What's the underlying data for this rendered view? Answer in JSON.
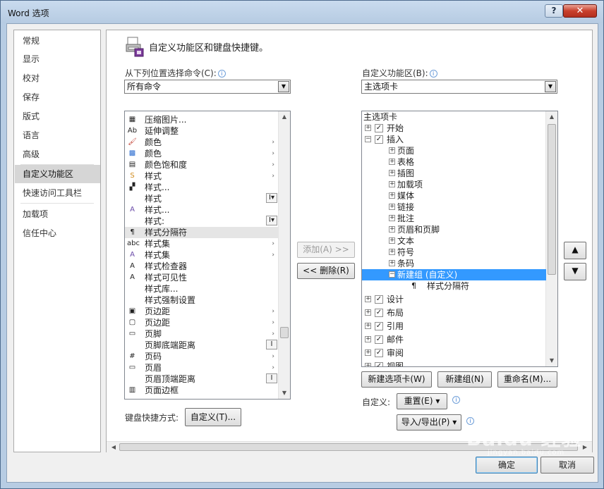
{
  "window": {
    "title": "Word 选项",
    "help_label": "?",
    "close_label": "✕"
  },
  "nav": {
    "items": [
      {
        "label": "常规"
      },
      {
        "label": "显示"
      },
      {
        "label": "校对"
      },
      {
        "label": "保存"
      },
      {
        "label": "版式"
      },
      {
        "label": "语言"
      },
      {
        "label": "高级"
      },
      {
        "label": "自定义功能区"
      },
      {
        "label": "快速访问工具栏"
      },
      {
        "label": "加载项"
      },
      {
        "label": "信任中心"
      }
    ],
    "active": "自定义功能区"
  },
  "main": {
    "heading": "自定义功能区和键盘快捷键。",
    "choose_label": "从下列位置选择命令(C):",
    "choose_value": "所有命令",
    "customize_label": "自定义功能区(B):",
    "customize_value": "主选项卡",
    "info_glyph": "i"
  },
  "commands": [
    {
      "icon": "compress-icon",
      "glyph": "▦",
      "label": "压缩图片..."
    },
    {
      "icon": "stretch-icon",
      "glyph": "Ab",
      "label": "延伸调整"
    },
    {
      "icon": "color-brush-icon",
      "glyph": "🖌",
      "label": "颜色",
      "chev": "›"
    },
    {
      "icon": "color-swatch-icon",
      "glyph": "▩",
      "label": "颜色",
      "chev": "›"
    },
    {
      "icon": "saturation-icon",
      "glyph": "▤",
      "label": "颜色饱和度",
      "chev": "›"
    },
    {
      "icon": "styles-icon",
      "glyph": "S",
      "label": "样式",
      "chev": "›"
    },
    {
      "icon": "style-small-icon",
      "glyph": "▞",
      "label": "样式..."
    },
    {
      "icon": "blank-icon",
      "glyph": "",
      "label": "样式",
      "mini": "I▾"
    },
    {
      "icon": "style-a-icon",
      "glyph": "A",
      "label": "样式..."
    },
    {
      "icon": "blank-icon",
      "glyph": "",
      "label": "样式:",
      "mini": "I▾"
    },
    {
      "icon": "style-separator-icon",
      "glyph": "¶",
      "label": "样式分隔符",
      "selected": true
    },
    {
      "icon": "abc-icon",
      "glyph": "abc",
      "label": "样式集",
      "chev": "›"
    },
    {
      "icon": "style-set-icon",
      "glyph": "A",
      "label": "样式集",
      "chev": "›"
    },
    {
      "icon": "style-inspector-icon",
      "glyph": "A",
      "label": "样式检查器"
    },
    {
      "icon": "style-visibility-icon",
      "glyph": "A",
      "label": "样式可见性"
    },
    {
      "icon": "blank-icon",
      "glyph": "",
      "label": "样式库..."
    },
    {
      "icon": "blank-icon",
      "glyph": "",
      "label": "样式强制设置"
    },
    {
      "icon": "margins-icon",
      "glyph": "▣",
      "label": "页边距",
      "chev": "›"
    },
    {
      "icon": "margins2-icon",
      "glyph": "▢",
      "label": "页边距",
      "chev": "›"
    },
    {
      "icon": "footer-icon",
      "glyph": "▭",
      "label": "页脚",
      "chev": "›"
    },
    {
      "icon": "blank-icon",
      "glyph": "",
      "label": "页脚底端距离",
      "mini": "I"
    },
    {
      "icon": "page-number-icon",
      "glyph": "#",
      "label": "页码",
      "chev": "›"
    },
    {
      "icon": "header-icon",
      "glyph": "▭",
      "label": "页眉",
      "chev": "›"
    },
    {
      "icon": "blank-icon",
      "glyph": "",
      "label": "页眉顶端距离",
      "mini": "I"
    },
    {
      "icon": "page-border-icon",
      "glyph": "▥",
      "label": "页面边框"
    }
  ],
  "ribbon_tree": [
    {
      "type": "header",
      "label": "主选项卡"
    },
    {
      "level": 0,
      "exp": "+",
      "check": true,
      "label": "开始"
    },
    {
      "level": 0,
      "exp": "−",
      "check": true,
      "label": "插入"
    },
    {
      "level": 1,
      "exp": "+",
      "label": "页面"
    },
    {
      "level": 1,
      "exp": "+",
      "label": "表格"
    },
    {
      "level": 1,
      "exp": "+",
      "label": "插图"
    },
    {
      "level": 1,
      "exp": "+",
      "label": "加载项"
    },
    {
      "level": 1,
      "exp": "+",
      "label": "媒体"
    },
    {
      "level": 1,
      "exp": "+",
      "label": "链接"
    },
    {
      "level": 1,
      "exp": "+",
      "label": "批注"
    },
    {
      "level": 1,
      "exp": "+",
      "label": "页眉和页脚"
    },
    {
      "level": 1,
      "exp": "+",
      "label": "文本"
    },
    {
      "level": 1,
      "exp": "+",
      "label": "符号"
    },
    {
      "level": 1,
      "exp": "+",
      "label": "条码"
    },
    {
      "level": 1,
      "exp": "−",
      "label": "新建组 (自定义)",
      "selected": true
    },
    {
      "level": 2,
      "icon": "¶",
      "label": "样式分隔符"
    },
    {
      "level": 0,
      "exp": "+",
      "check": true,
      "label": "设计"
    },
    {
      "level": 0,
      "exp": "+",
      "check": true,
      "label": "布局"
    },
    {
      "level": 0,
      "exp": "+",
      "check": true,
      "label": "引用"
    },
    {
      "level": 0,
      "exp": "+",
      "check": true,
      "label": "邮件"
    },
    {
      "level": 0,
      "exp": "+",
      "check": true,
      "label": "审阅"
    },
    {
      "level": 0,
      "exp": "+",
      "check": true,
      "label": "视图"
    }
  ],
  "buttons": {
    "add": "添加(A) >>",
    "remove": "<< 删除(R)",
    "new_tab": "新建选项卡(W)",
    "new_group": "新建组(N)",
    "rename": "重命名(M)...",
    "customize_label": "自定义:",
    "reset": "重置(E) ▾",
    "import_export": "导入/导出(P) ▾",
    "keyboard_label": "键盘快捷方式:",
    "keyboard_customize": "自定义(T)...",
    "move_up": "▲",
    "move_down": "▼",
    "ok": "确定",
    "cancel": "取消"
  },
  "watermark": {
    "text": "Baidu 经验",
    "sub": "jingyan.baidu.com"
  }
}
